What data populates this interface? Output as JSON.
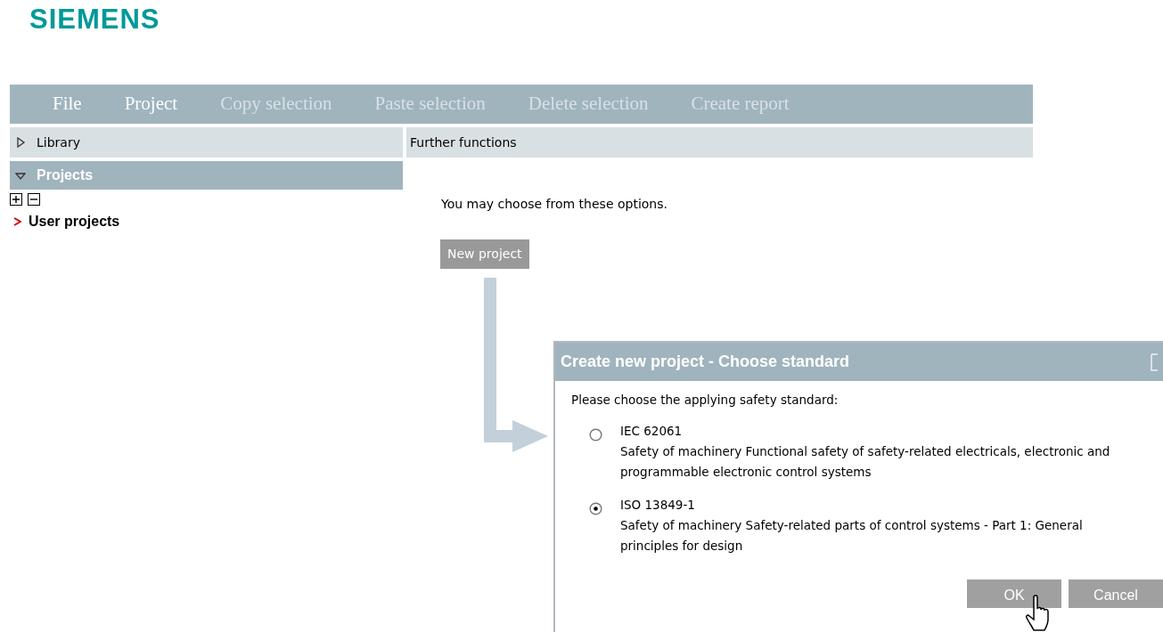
{
  "logo": {
    "text": "SIEMENS"
  },
  "menu": [
    {
      "label": "File",
      "disabled": false
    },
    {
      "label": "Project",
      "disabled": false
    },
    {
      "label": "Copy selection",
      "disabled": true
    },
    {
      "label": "Paste selection",
      "disabled": true
    },
    {
      "label": "Delete selection",
      "disabled": true
    },
    {
      "label": "Create report",
      "disabled": true
    }
  ],
  "sidebar": {
    "sections": [
      {
        "label": "Library",
        "expanded": false
      },
      {
        "label": "Projects",
        "expanded": true
      }
    ],
    "tree": {
      "items": [
        {
          "label": "User projects"
        }
      ]
    }
  },
  "content": {
    "header": "Further functions",
    "text": "You may choose from these options.",
    "button": "New project"
  },
  "dialog": {
    "title": "Create new project - Choose standard",
    "prompt": "Please choose the applying safety standard:",
    "options": [
      {
        "code": "IEC 62061",
        "description": "Safety of machinery Functional safety of safety-related electricals, electronic and programmable electronic control systems",
        "selected": false
      },
      {
        "code": "ISO 13849-1",
        "description": "Safety of machinery Safety-related parts of control systems - Part 1: General principles for design",
        "selected": true
      }
    ],
    "buttons": [
      "OK",
      "Cancel"
    ]
  }
}
